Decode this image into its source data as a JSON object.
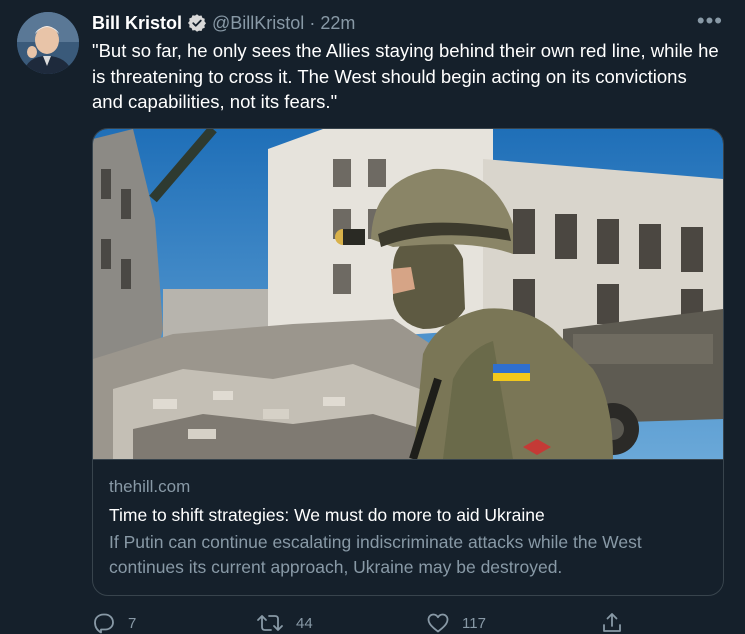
{
  "tweet": {
    "display_name": "Bill Kristol",
    "verified_icon": "verified-badge-icon",
    "handle": "@BillKristol",
    "separator": "·",
    "time": "22m",
    "more_icon": "more-horizontal-icon",
    "more_label": "•••",
    "text": "\"But so far, he only sees the Allies staying behind their own red line, while he is threatening to cross it. The West should begin acting on its convictions and capabilities, not its fears.\""
  },
  "card": {
    "image_icon": "news-photo-soldier-icon",
    "domain": "thehill.com",
    "title": "Time to shift strategies: We must do more to aid Ukraine",
    "description": "If Putin can continue escalating indiscriminate attacks while the West continues its current approach, Ukraine may be destroyed."
  },
  "actions": {
    "reply": {
      "icon": "reply-icon",
      "count": "7"
    },
    "retweet": {
      "icon": "retweet-icon",
      "count": "44"
    },
    "like": {
      "icon": "heart-icon",
      "count": "117"
    },
    "share": {
      "icon": "share-icon"
    }
  },
  "colors": {
    "background": "#15202b",
    "primary_text": "#ffffff",
    "secondary_text": "#8899a6",
    "border": "#38444d",
    "verified": "#1d9bf0"
  }
}
